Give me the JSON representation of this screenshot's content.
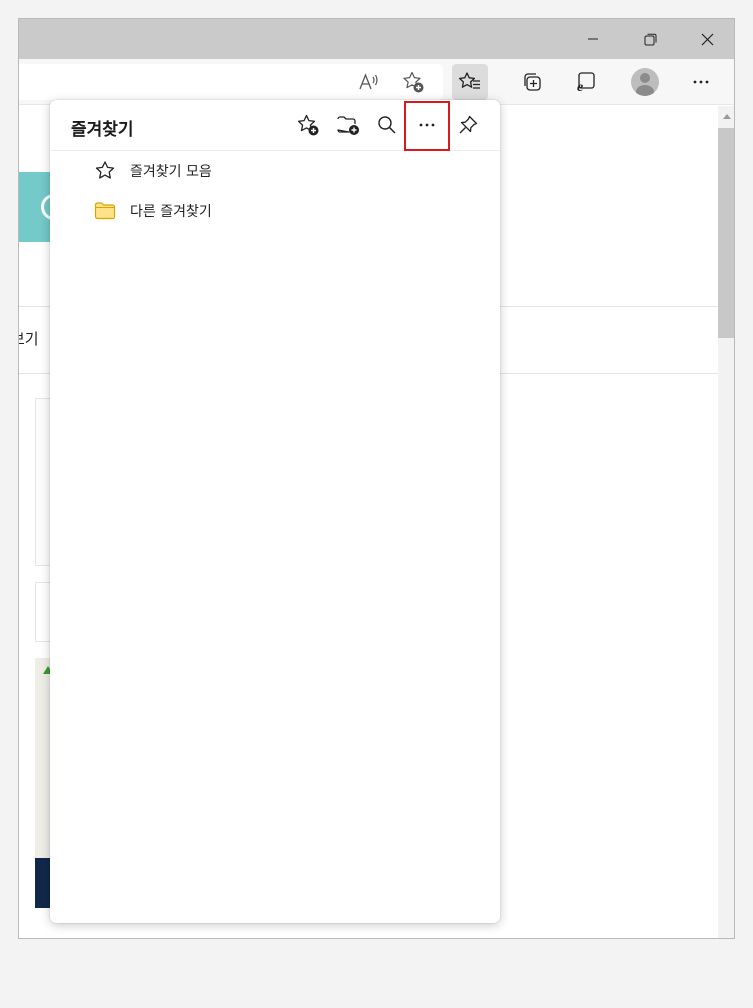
{
  "window": {
    "controls": {
      "minimize_icon": "minimize-icon",
      "restore_icon": "restore-icon",
      "close_icon": "close-icon"
    }
  },
  "toolbar": {
    "read_aloud_icon": "read-aloud-icon",
    "add_favorite_icon": "add-favorite-icon",
    "favorites_icon": "favorites-icon",
    "collections_icon": "collections-icon",
    "ie_mode_icon": "internet-explorer-icon",
    "profile_icon": "profile-avatar",
    "more_icon": "more-icon"
  },
  "page": {
    "partial_text": "보기"
  },
  "favorites_panel": {
    "title": "즐겨찾기",
    "actions": [
      {
        "name": "add-this-page",
        "icon": "star-plus-icon"
      },
      {
        "name": "add-folder",
        "icon": "folder-plus-icon"
      },
      {
        "name": "search",
        "icon": "search-icon"
      },
      {
        "name": "more-options",
        "icon": "more-icon",
        "highlighted": true
      },
      {
        "name": "pin",
        "icon": "pin-icon"
      }
    ],
    "items": [
      {
        "label": "즐겨찾기 모음",
        "icon": "star-icon"
      },
      {
        "label": "다른 즐겨찾기",
        "icon": "folder-icon"
      }
    ]
  },
  "colors": {
    "highlight_box": "#d71920",
    "folder_fill": "#ffe38a",
    "folder_stroke": "#d9a300",
    "titlebar": "#cacaca",
    "page_accent": "#74c9c9"
  }
}
